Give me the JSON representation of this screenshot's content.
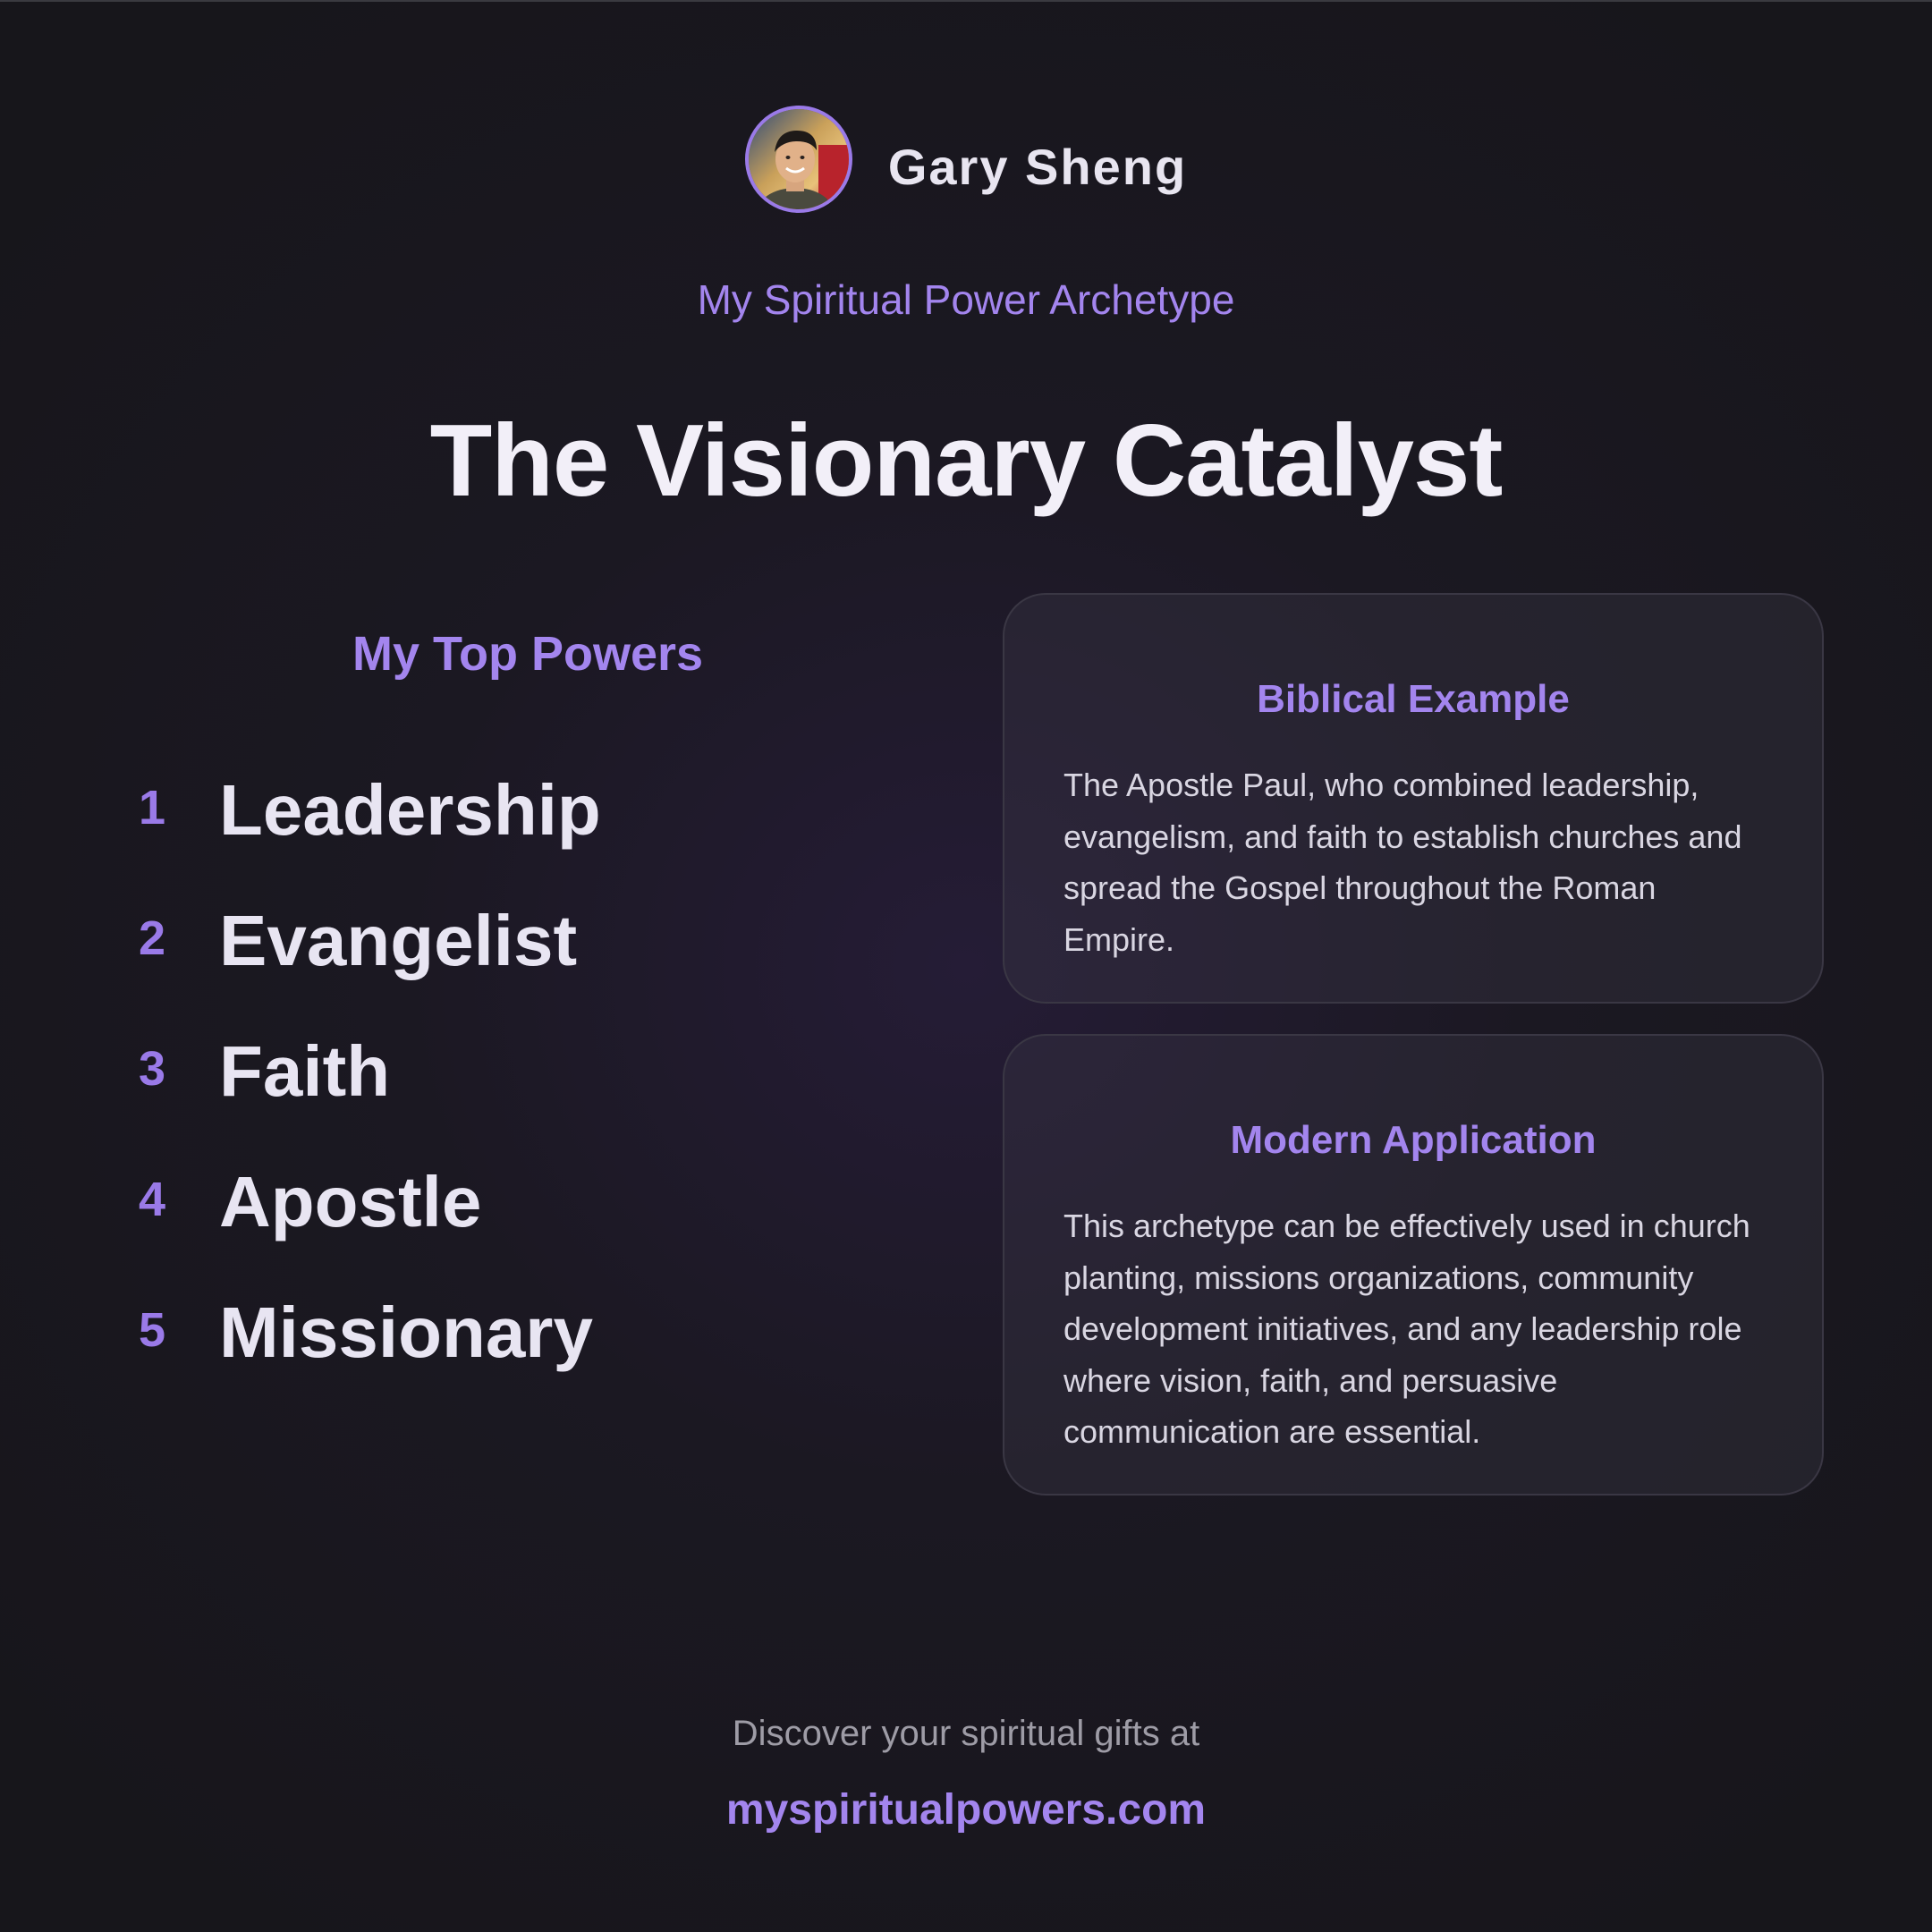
{
  "profile": {
    "name": "Gary Sheng",
    "avatar_icon": "user-avatar-photo"
  },
  "header": {
    "subtitle": "My Spiritual Power Archetype",
    "archetype": "The Visionary Catalyst"
  },
  "powers": {
    "title": "My Top Powers",
    "items": [
      {
        "rank": "1",
        "label": "Leadership"
      },
      {
        "rank": "2",
        "label": "Evangelist"
      },
      {
        "rank": "3",
        "label": "Faith"
      },
      {
        "rank": "4",
        "label": "Apostle"
      },
      {
        "rank": "5",
        "label": "Missionary"
      }
    ]
  },
  "cards": {
    "biblical": {
      "title": "Biblical Example",
      "body": "The Apostle Paul, who combined leadership, evangelism, and faith to establish churches and spread the Gospel throughout the Roman Empire."
    },
    "modern": {
      "title": "Modern Application",
      "body": "This archetype can be effectively used in church planting, missions organizations, community development initiatives, and any leadership role where vision, faith, and persuasive communication are essential."
    }
  },
  "footer": {
    "text": "Discover your spiritual gifts at",
    "link": "myspiritualpowers.com"
  },
  "colors": {
    "accent": "#a385ee",
    "background": "#17161b",
    "text": "#ece9f5"
  }
}
